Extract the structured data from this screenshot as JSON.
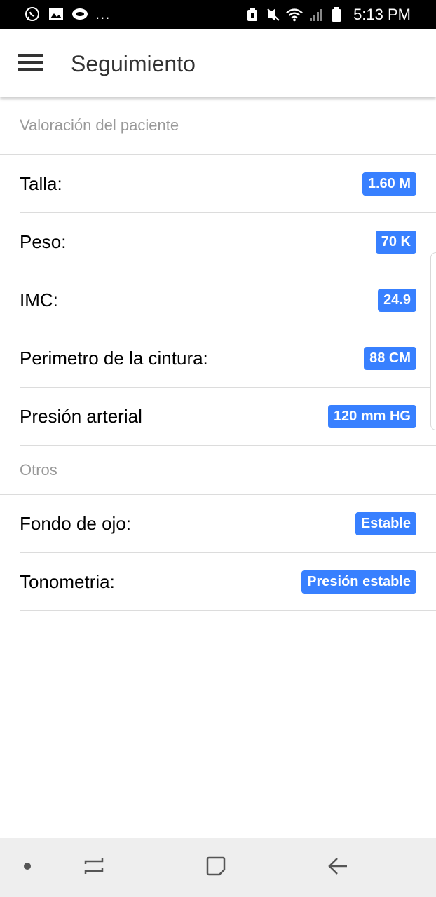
{
  "status_bar": {
    "time": "5:13 PM",
    "overflow": "...",
    "icons_left": [
      "whatsapp-icon",
      "image-icon",
      "cloud-icon"
    ],
    "icons_right": [
      "alarm-icon",
      "vibrate-icon",
      "wifi-icon",
      "signal-icon",
      "battery-icon"
    ]
  },
  "toolbar": {
    "title": "Seguimiento",
    "menu_icon": "hamburger-menu-icon"
  },
  "sections": {
    "assessment": {
      "title": "Valoración del paciente",
      "items": [
        {
          "label": "Talla:",
          "value": "1.60 M"
        },
        {
          "label": "Peso:",
          "value": "70 K"
        },
        {
          "label": "IMC:",
          "value": "24.9"
        },
        {
          "label": "Perimetro de la cintura:",
          "value": "88 CM"
        },
        {
          "label": "Presión arterial",
          "value": "120 mm HG"
        }
      ]
    },
    "others": {
      "title": "Otros",
      "items": [
        {
          "label": "Fondo de ojo:",
          "value": "Estable"
        },
        {
          "label": "Tonometria:",
          "value": "Presión estable"
        }
      ]
    }
  },
  "colors": {
    "accent": "#3880ff",
    "status_bar": "#000000",
    "nav_bar": "#eeeeee",
    "section_header_text": "#999999"
  },
  "nav_bar": {
    "icons": [
      "dot-icon",
      "recent-apps-icon",
      "home-icon",
      "back-icon"
    ]
  }
}
